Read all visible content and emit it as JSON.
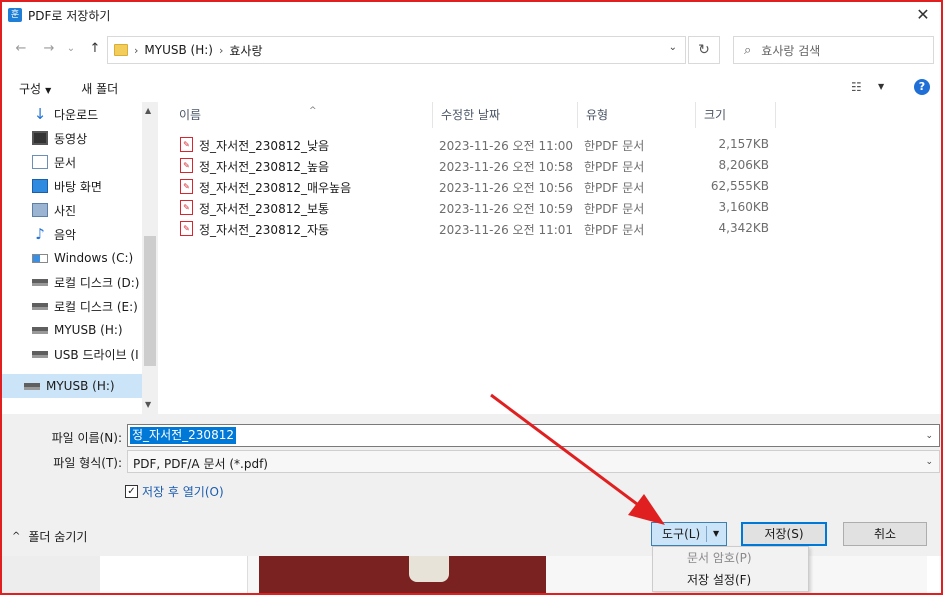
{
  "dialog": {
    "app_icon": "훈",
    "title": "PDF로 저장하기",
    "close": "✕"
  },
  "address": {
    "back": "←",
    "forward": "→",
    "history": "⌄",
    "up": "↑",
    "sep1": "›",
    "crumb1": "MYUSB (H:)",
    "sep2": "›",
    "crumb2": "효사랑",
    "dropdown": "⌄",
    "refresh": "↻",
    "search_placeholder": "효사랑 검색",
    "search_icon": "⌕"
  },
  "toolbar": {
    "organize": "구성",
    "organize_caret": "▼",
    "new_folder": "새 폴더",
    "view_icon": "☷",
    "view_caret": "▼",
    "help": "?"
  },
  "nav": {
    "items": [
      {
        "label": "다운로드",
        "icon": "↓"
      },
      {
        "label": "동영상"
      },
      {
        "label": "문서"
      },
      {
        "label": "바탕 화면"
      },
      {
        "label": "사진"
      },
      {
        "label": "음악",
        "icon": "♪"
      },
      {
        "label": "Windows (C:)"
      },
      {
        "label": "로컬 디스크 (D:)"
      },
      {
        "label": "로컬 디스크 (E:)"
      },
      {
        "label": "MYUSB (H:)"
      },
      {
        "label": "USB 드라이브 (I"
      },
      {
        "label": "MYUSB (H:)"
      }
    ],
    "scroll_up": "▲",
    "scroll_down": "▼"
  },
  "columns": {
    "name": "이름",
    "sort_caret": "^",
    "date": "수정한 날짜",
    "type": "유형",
    "size": "크기"
  },
  "files": [
    {
      "name": "정_자서전_230812_낮음",
      "date": "2023-11-26 오전 11:00",
      "type": "한PDF 문서",
      "size": "2,157KB"
    },
    {
      "name": "정_자서전_230812_높음",
      "date": "2023-11-26 오전 10:58",
      "type": "한PDF 문서",
      "size": "8,206KB"
    },
    {
      "name": "정_자서전_230812_매우높음",
      "date": "2023-11-26 오전 10:56",
      "type": "한PDF 문서",
      "size": "62,555KB"
    },
    {
      "name": "정_자서전_230812_보통",
      "date": "2023-11-26 오전 10:59",
      "type": "한PDF 문서",
      "size": "3,160KB"
    },
    {
      "name": "정_자서전_230812_자동",
      "date": "2023-11-26 오전 11:01",
      "type": "한PDF 문서",
      "size": "4,342KB"
    }
  ],
  "form": {
    "filename_label": "파일 이름(N):",
    "filename_value": "정_자서전_230812",
    "filetype_label": "파일 형식(T):",
    "filetype_value": "PDF, PDF/A 문서 (*.pdf)",
    "dd_caret": "⌄",
    "open_after_checked": "✓",
    "open_after_label": "저장 후 열기(O)",
    "hide_folders_chevron": "^",
    "hide_folders": "폴더 숨기기"
  },
  "buttons": {
    "tools": "도구(L)",
    "tools_caret": "▼",
    "save": "저장(S)",
    "cancel": "취소"
  },
  "tools_menu": {
    "items": [
      {
        "label": "문서 암호(P)",
        "enabled": false
      },
      {
        "label": "저장 설정(F)",
        "enabled": true
      }
    ]
  },
  "colors": {
    "accent": "#0078d7",
    "annotation": "#e02020",
    "pdf_icon": "#d7262f"
  }
}
